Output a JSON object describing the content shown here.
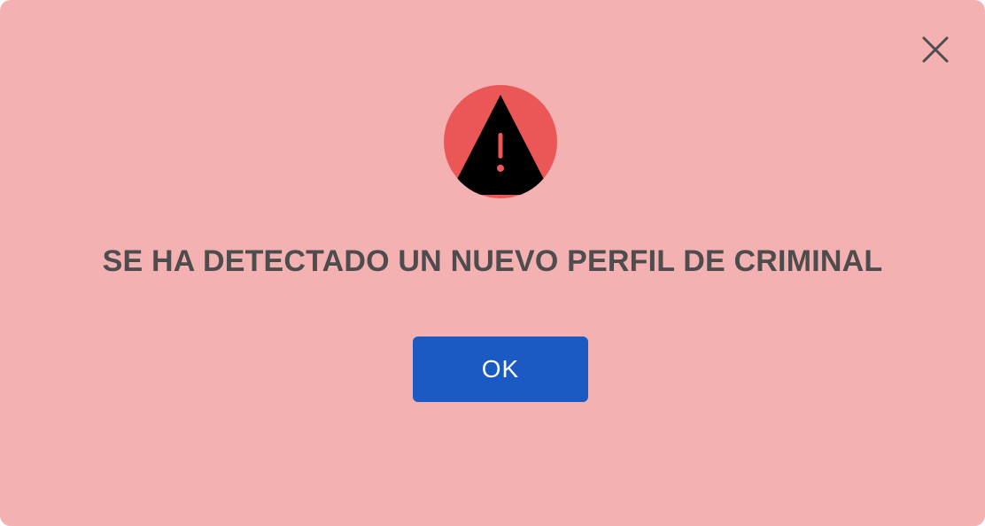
{
  "dialog": {
    "close_icon": "close-icon",
    "warning_icon": "warning-triangle-icon",
    "message": "SE HA DETECTADO UN NUEVO PERFIL DE CRIMINAL",
    "ok_label": "OK"
  },
  "colors": {
    "background": "#f4b1b2",
    "icon_circle": "#eb5757",
    "icon_triangle": "#000000",
    "message_text": "#4f4c4e",
    "button": "#1a5ac2",
    "button_text": "#ffffff",
    "close_icon": "#4f4c4e"
  }
}
